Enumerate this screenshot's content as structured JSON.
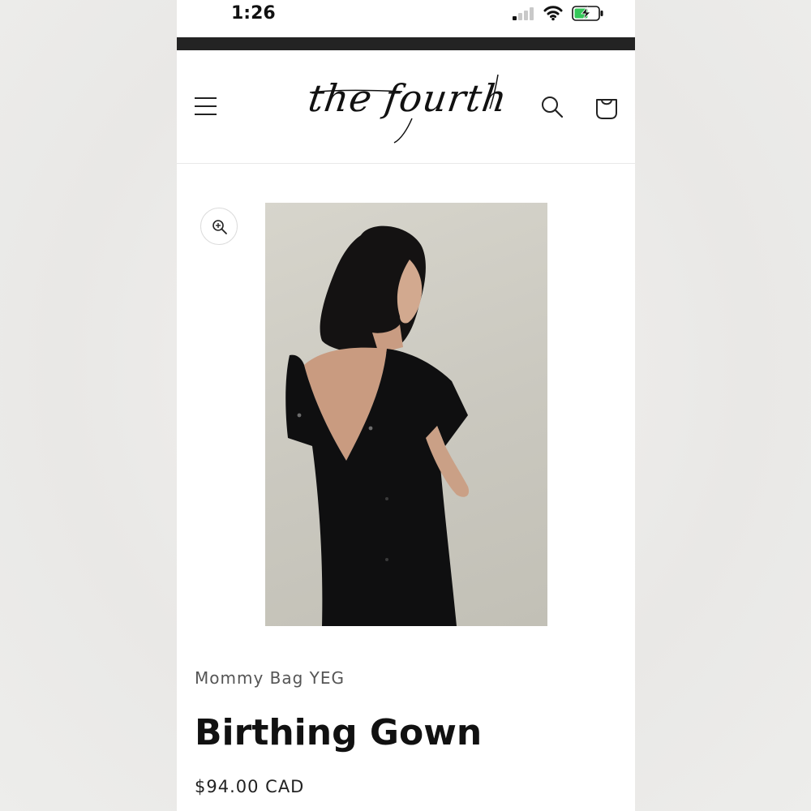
{
  "status_bar": {
    "time": "1:26",
    "icons": [
      "cellular-signal-icon",
      "wifi-icon",
      "battery-charging-icon"
    ],
    "battery_color": "#34c759"
  },
  "header": {
    "logo_text": "the fourth",
    "icons": [
      "hamburger-menu-icon",
      "search-icon",
      "cart-icon"
    ]
  },
  "product": {
    "zoom_icon": "zoom-in-icon",
    "image_alt": "Woman wearing black open-back birthing gown",
    "vendor": "Mommy Bag YEG",
    "title": "Birthing Gown",
    "price": "$94.00 CAD"
  },
  "colors": {
    "strip": "#232323",
    "text": "#111111",
    "photo_background": "#cfcdc4"
  }
}
